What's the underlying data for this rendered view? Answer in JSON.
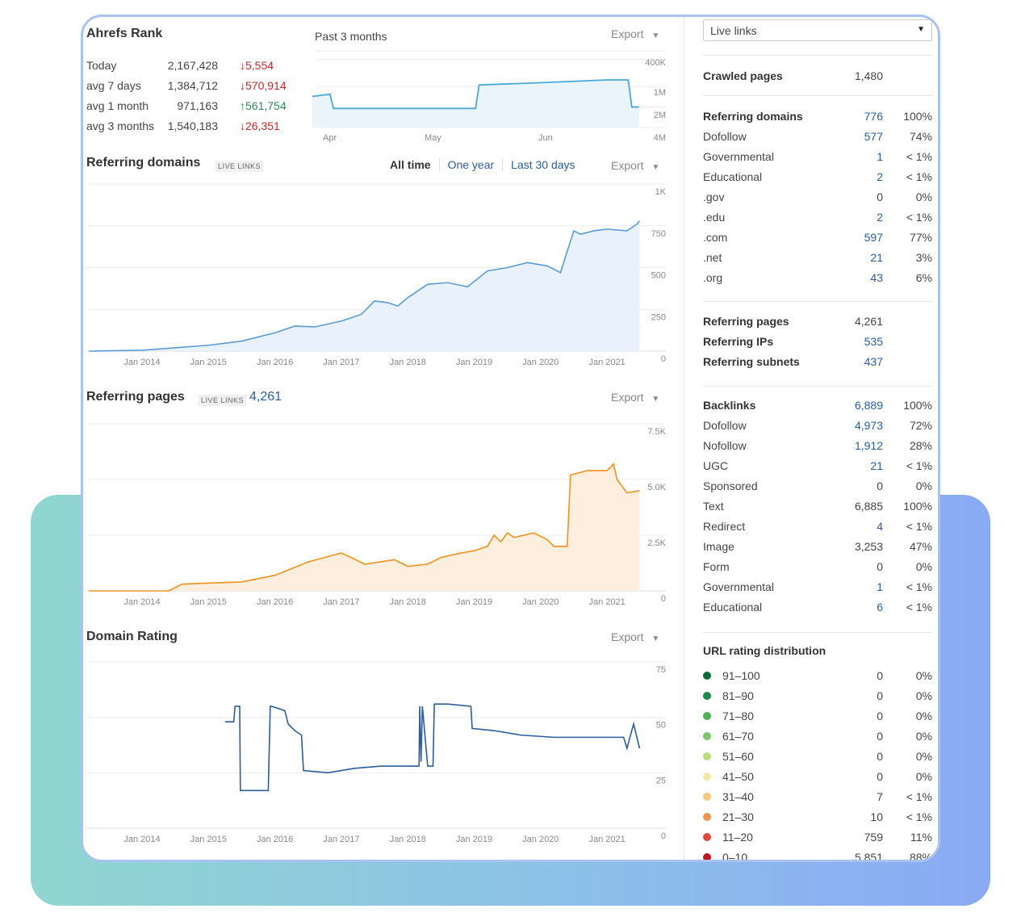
{
  "rank": {
    "title": "Ahrefs Rank",
    "rows": [
      {
        "label": "Today",
        "value": "2,167,428",
        "change": "5,554",
        "dir": "down"
      },
      {
        "label": "avg 7 days",
        "value": "1,384,712",
        "change": "570,914",
        "dir": "down"
      },
      {
        "label": "avg 1 month",
        "value": "971,163",
        "change": "561,754",
        "dir": "up"
      },
      {
        "label": "avg 3 months",
        "value": "1,540,183",
        "change": "26,351",
        "dir": "down"
      }
    ]
  },
  "export_label": "Export",
  "rank_chart": {
    "period": "Past 3 months",
    "type": "line",
    "y_scale": "log-inverted",
    "y_ticks": [
      "400K",
      "1M",
      "2M",
      "4M"
    ],
    "x_ticks": [
      "Apr",
      "May",
      "Jun"
    ],
    "color": "#4aa8d8",
    "points": [
      [
        "2021-03-29",
        1400000
      ],
      [
        "2021-04-03",
        1300000
      ],
      [
        "2021-04-04",
        2100000
      ],
      [
        "2021-05-14",
        2100000
      ],
      [
        "2021-05-15",
        950000
      ],
      [
        "2021-06-01",
        880000
      ],
      [
        "2021-06-20",
        800000
      ],
      [
        "2021-06-26",
        800000
      ],
      [
        "2021-06-27",
        2000000
      ],
      [
        "2021-06-29",
        2000000
      ]
    ]
  },
  "ref_domains": {
    "title": "Referring domains",
    "badge": "LIVE LINKS",
    "ranges": [
      "All time",
      "One year",
      "Last 30 days"
    ],
    "active_range": "All time"
  },
  "ref_pages": {
    "title": "Referring pages",
    "badge": "LIVE LINKS",
    "count": "4,261"
  },
  "domain_rating": {
    "title": "Domain Rating"
  },
  "chart_data": [
    {
      "type": "area",
      "series": "Referring domains",
      "color": "#5b9bd5",
      "ylim": [
        0,
        1000
      ],
      "y_ticks": [
        "0",
        "250",
        "500",
        "750",
        "1K"
      ],
      "x_ticks": [
        "Jan 2014",
        "Jan 2015",
        "Jan 2016",
        "Jan 2017",
        "Jan 2018",
        "Jan 2019",
        "Jan 2020",
        "Jan 2021"
      ],
      "x": [
        2013.2,
        2014,
        2014.5,
        2015,
        2015.5,
        2016,
        2016.3,
        2016.6,
        2017,
        2017.3,
        2017.5,
        2017.7,
        2017.85,
        2018,
        2018.3,
        2018.6,
        2018.9,
        2019.2,
        2019.5,
        2019.8,
        2020.1,
        2020.3,
        2020.37,
        2020.5,
        2020.6,
        2020.8,
        2021,
        2021.3,
        2021.45,
        2021.49
      ],
      "y": [
        0,
        5,
        20,
        35,
        60,
        110,
        150,
        145,
        180,
        220,
        300,
        290,
        270,
        320,
        400,
        410,
        385,
        480,
        500,
        530,
        510,
        470,
        560,
        720,
        700,
        720,
        730,
        720,
        760,
        780
      ]
    },
    {
      "type": "area",
      "series": "Referring pages",
      "color": "#f0931e",
      "ylim": [
        0,
        7500
      ],
      "y_ticks": [
        "0",
        "2.5K",
        "5.0K",
        "7.5K"
      ],
      "x_ticks": [
        "Jan 2014",
        "Jan 2015",
        "Jan 2016",
        "Jan 2017",
        "Jan 2018",
        "Jan 2019",
        "Jan 2020",
        "Jan 2021"
      ],
      "x": [
        2013.2,
        2014.4,
        2014.6,
        2015,
        2015.5,
        2016,
        2016.5,
        2017,
        2017.15,
        2017.35,
        2017.8,
        2018,
        2018.3,
        2018.5,
        2018.8,
        2019,
        2019.2,
        2019.3,
        2019.4,
        2019.5,
        2019.6,
        2019.9,
        2020.1,
        2020.2,
        2020.4,
        2020.45,
        2020.7,
        2021,
        2021.1,
        2021.15,
        2021.3,
        2021.49
      ],
      "y": [
        0,
        0,
        300,
        350,
        400,
        700,
        1300,
        1700,
        1500,
        1200,
        1400,
        1100,
        1200,
        1500,
        1700,
        1800,
        2000,
        2500,
        2200,
        2600,
        2400,
        2600,
        2300,
        2000,
        2000,
        5200,
        5400,
        5400,
        5700,
        5000,
        4400,
        4500
      ]
    },
    {
      "type": "line",
      "series": "Domain Rating",
      "color": "#2b5e9a",
      "ylim": [
        0,
        75
      ],
      "y_ticks": [
        "0",
        "25",
        "50",
        "75"
      ],
      "x_ticks": [
        "Jan 2014",
        "Jan 2015",
        "Jan 2016",
        "Jan 2017",
        "Jan 2018",
        "Jan 2019",
        "Jan 2020",
        "Jan 2021"
      ],
      "x": [
        2015.25,
        2015.38,
        2015.4,
        2015.47,
        2015.48,
        2015.9,
        2015.93,
        2015.95,
        2016.15,
        2016.2,
        2016.3,
        2016.4,
        2016.43,
        2016.8,
        2017.2,
        2017.6,
        2018.17,
        2018.18,
        2018.2,
        2018.22,
        2018.3,
        2018.38,
        2018.4,
        2018.6,
        2018.95,
        2018.97,
        2019.3,
        2019.7,
        2020.2,
        2020.8,
        2021.25,
        2021.3,
        2021.4,
        2021.49
      ],
      "y": [
        48,
        48,
        55,
        55,
        17,
        17,
        55,
        55,
        53,
        47,
        44,
        42,
        26,
        25,
        27,
        28,
        28,
        55,
        30,
        55,
        28,
        28,
        56,
        56,
        55,
        45,
        44,
        42,
        41,
        41,
        41,
        36,
        47,
        36
      ]
    }
  ],
  "side": {
    "select": "Live links",
    "crawled": {
      "label": "Crawled pages",
      "value": "1,480"
    },
    "domains": [
      {
        "l": "Referring domains",
        "n": "776",
        "p": "100%",
        "b": true,
        "link": true
      },
      {
        "l": "Dofollow",
        "n": "577",
        "p": "74%",
        "link": true
      },
      {
        "l": "Governmental",
        "n": "1",
        "p": "< 1%",
        "link": true
      },
      {
        "l": "Educational",
        "n": "2",
        "p": "< 1%",
        "link": true
      },
      {
        "l": ".gov",
        "n": "0",
        "p": "0%"
      },
      {
        "l": ".edu",
        "n": "2",
        "p": "< 1%",
        "link": true
      },
      {
        "l": ".com",
        "n": "597",
        "p": "77%",
        "link": true
      },
      {
        "l": ".net",
        "n": "21",
        "p": "3%",
        "link": true
      },
      {
        "l": ".org",
        "n": "43",
        "p": "6%",
        "link": true
      }
    ],
    "pages": [
      {
        "l": "Referring pages",
        "n": "4,261",
        "b": true
      },
      {
        "l": "Referring IPs",
        "n": "535",
        "b": true,
        "link": true
      },
      {
        "l": "Referring subnets",
        "n": "437",
        "b": true,
        "link": true
      }
    ],
    "backlinks": [
      {
        "l": "Backlinks",
        "n": "6,889",
        "p": "100%",
        "b": true,
        "link": true
      },
      {
        "l": "Dofollow",
        "n": "4,973",
        "p": "72%",
        "link": true
      },
      {
        "l": "Nofollow",
        "n": "1,912",
        "p": "28%",
        "link": true
      },
      {
        "l": "UGC",
        "n": "21",
        "p": "< 1%",
        "link": true
      },
      {
        "l": "Sponsored",
        "n": "0",
        "p": "0%"
      },
      {
        "l": "Text",
        "n": "6,885",
        "p": "100%"
      },
      {
        "l": "Redirect",
        "n": "4",
        "p": "< 1%",
        "link": true
      },
      {
        "l": "Image",
        "n": "3,253",
        "p": "47%"
      },
      {
        "l": "Form",
        "n": "0",
        "p": "0%"
      },
      {
        "l": "Governmental",
        "n": "1",
        "p": "< 1%",
        "link": true
      },
      {
        "l": "Educational",
        "n": "6",
        "p": "< 1%",
        "link": true
      }
    ],
    "url_title": "URL rating distribution",
    "url": [
      {
        "l": "91–100",
        "n": "0",
        "p": "0%",
        "c": "#0b6b3a"
      },
      {
        "l": "81–90",
        "n": "0",
        "p": "0%",
        "c": "#1e8a47"
      },
      {
        "l": "71–80",
        "n": "0",
        "p": "0%",
        "c": "#4caf50"
      },
      {
        "l": "61–70",
        "n": "0",
        "p": "0%",
        "c": "#7cc66a"
      },
      {
        "l": "51–60",
        "n": "0",
        "p": "0%",
        "c": "#b8dd7a"
      },
      {
        "l": "41–50",
        "n": "0",
        "p": "0%",
        "c": "#eeeaa0"
      },
      {
        "l": "31–40",
        "n": "7",
        "p": "< 1%",
        "c": "#f8c77e"
      },
      {
        "l": "21–30",
        "n": "10",
        "p": "< 1%",
        "c": "#f2944f"
      },
      {
        "l": "11–20",
        "n": "759",
        "p": "11%",
        "c": "#e0483a"
      },
      {
        "l": "0–10",
        "n": "5,851",
        "p": "88%",
        "c": "#c2151e"
      }
    ]
  }
}
